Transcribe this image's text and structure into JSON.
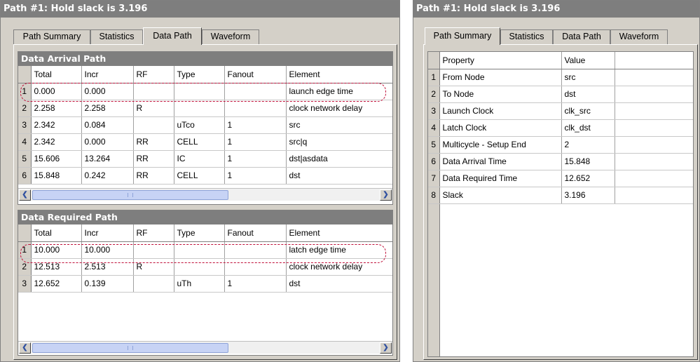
{
  "left_panel": {
    "title": "Path #1: Hold slack is 3.196",
    "tabs": [
      "Path Summary",
      "Statistics",
      "Data Path",
      "Waveform"
    ],
    "active_tab": "Data Path",
    "arrival": {
      "title": "Data Arrival Path",
      "columns": [
        "Total",
        "Incr",
        "RF",
        "Type",
        "Fanout",
        "Element"
      ],
      "rows": [
        {
          "n": "1",
          "total": "0.000",
          "incr": "0.000",
          "rf": "",
          "type": "",
          "fanout": "",
          "element": "launch edge time"
        },
        {
          "n": "2",
          "total": "2.258",
          "incr": "2.258",
          "rf": "R",
          "type": "",
          "fanout": "",
          "element": "clock network delay"
        },
        {
          "n": "3",
          "total": "2.342",
          "incr": "0.084",
          "rf": "",
          "type": "uTco",
          "fanout": "1",
          "element": "src"
        },
        {
          "n": "4",
          "total": "2.342",
          "incr": "0.000",
          "rf": "RR",
          "type": "CELL",
          "fanout": "1",
          "element": "src|q"
        },
        {
          "n": "5",
          "total": "15.606",
          "incr": "13.264",
          "rf": "RR",
          "type": "IC",
          "fanout": "1",
          "element": "dst|asdata"
        },
        {
          "n": "6",
          "total": "15.848",
          "incr": "0.242",
          "rf": "RR",
          "type": "CELL",
          "fanout": "1",
          "element": "dst"
        }
      ]
    },
    "required": {
      "title": "Data Required Path",
      "columns": [
        "Total",
        "Incr",
        "RF",
        "Type",
        "Fanout",
        "Element"
      ],
      "rows": [
        {
          "n": "1",
          "total": "10.000",
          "incr": "10.000",
          "rf": "",
          "type": "",
          "fanout": "",
          "element": "latch edge time"
        },
        {
          "n": "2",
          "total": "12.513",
          "incr": "2.513",
          "rf": "R",
          "type": "",
          "fanout": "",
          "element": "clock network delay"
        },
        {
          "n": "3",
          "total": "12.652",
          "incr": "0.139",
          "rf": "",
          "type": "uTh",
          "fanout": "1",
          "element": "dst"
        }
      ]
    }
  },
  "right_panel": {
    "title": "Path #1: Hold slack is 3.196",
    "tabs": [
      "Path Summary",
      "Statistics",
      "Data Path",
      "Waveform"
    ],
    "active_tab": "Path Summary",
    "columns": [
      "Property",
      "Value"
    ],
    "rows": [
      {
        "n": "1",
        "property": "From Node",
        "value": "src"
      },
      {
        "n": "2",
        "property": "To Node",
        "value": "dst"
      },
      {
        "n": "3",
        "property": "Launch Clock",
        "value": "clk_src"
      },
      {
        "n": "4",
        "property": "Latch Clock",
        "value": "clk_dst"
      },
      {
        "n": "5",
        "property": "Multicycle - Setup End",
        "value": "2"
      },
      {
        "n": "6",
        "property": "Data Arrival Time",
        "value": "15.848"
      },
      {
        "n": "7",
        "property": "Data Required Time",
        "value": "12.652"
      },
      {
        "n": "8",
        "property": "Slack",
        "value": "3.196"
      }
    ]
  },
  "icons": {
    "scroll_left": "arrow-left-icon",
    "scroll_right": "arrow-right-icon"
  },
  "colors": {
    "title_bar": "#7e7e7e",
    "highlight": "#c0103a",
    "panel_bg": "#d4d0c8"
  }
}
